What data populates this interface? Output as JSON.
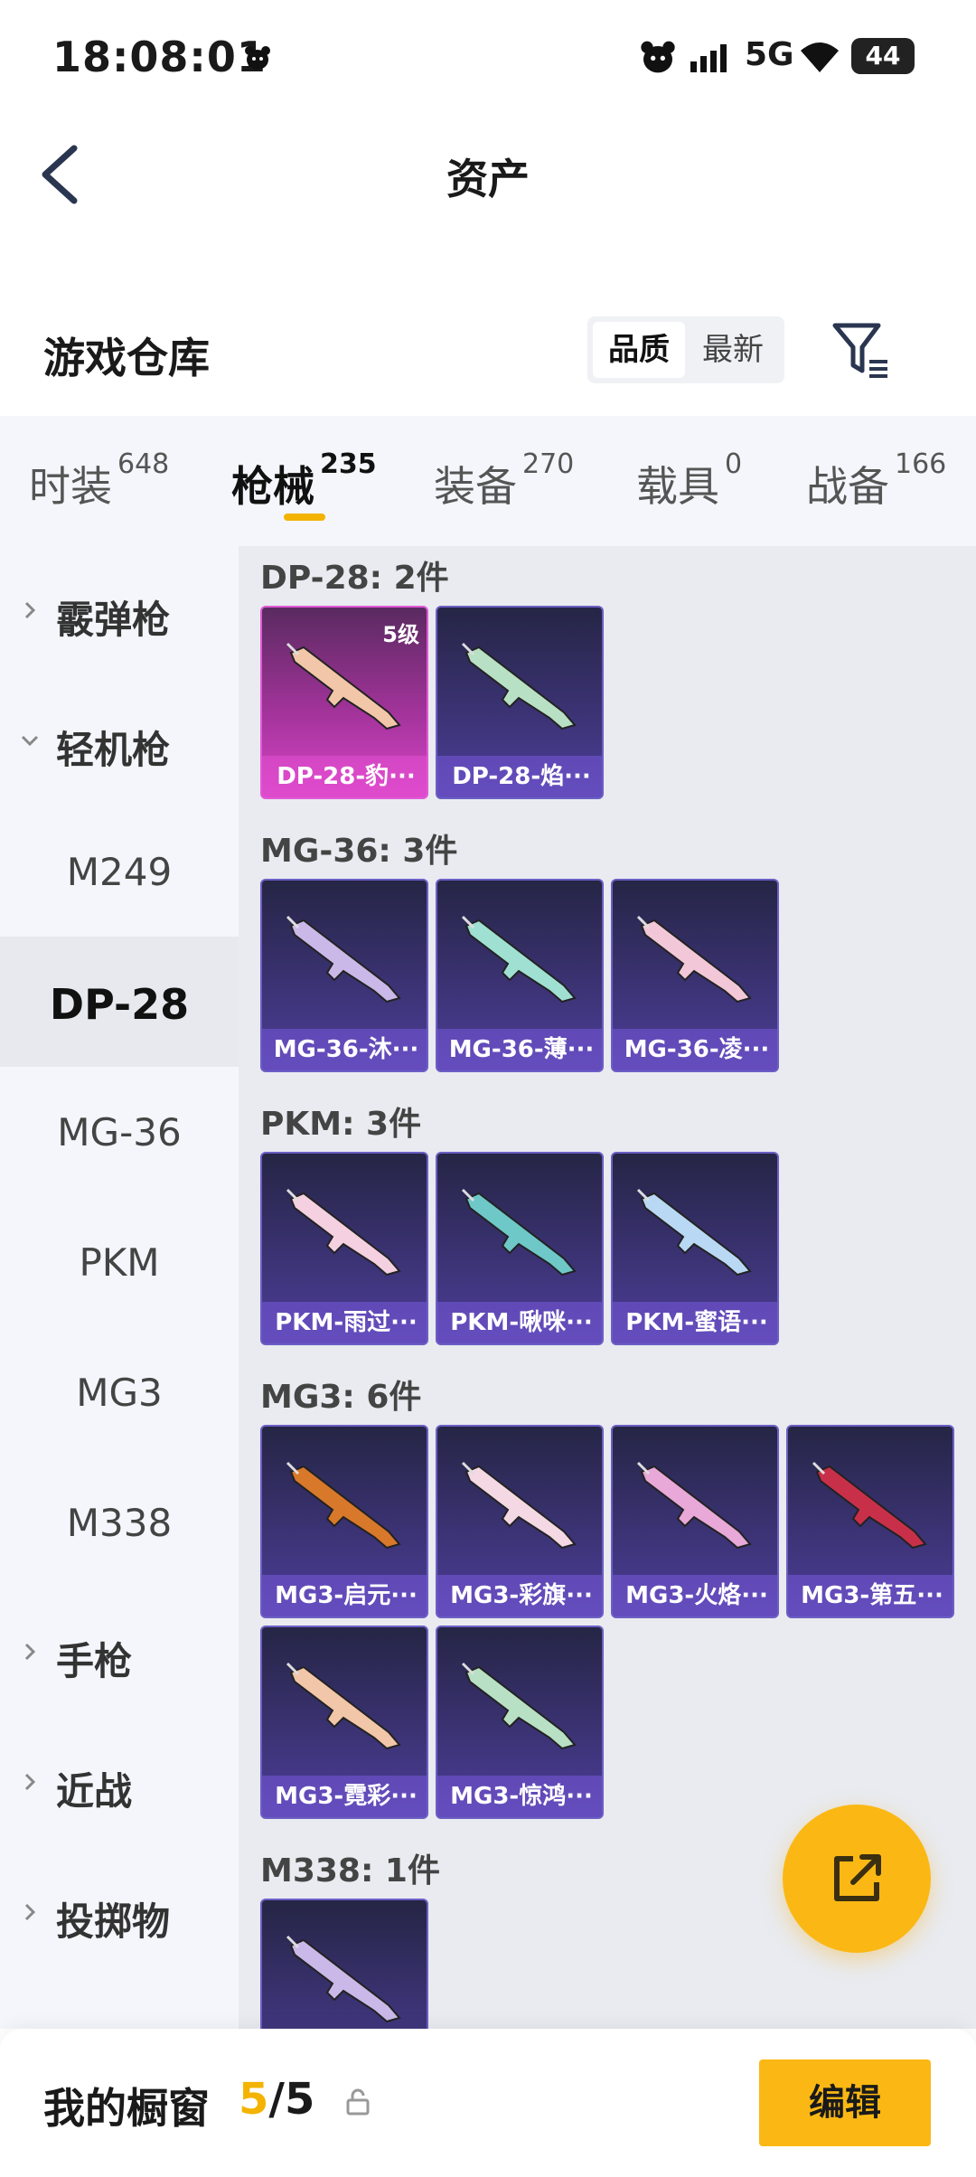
{
  "status_bar": {
    "time": "18:08:01",
    "network": "5G",
    "battery": "44"
  },
  "header": {
    "title": "资产"
  },
  "section": {
    "title": "游戏仓库",
    "sort_options": [
      "品质",
      "最新"
    ]
  },
  "tabs": [
    {
      "label": "时装",
      "count": "648"
    },
    {
      "label": "枪械",
      "count": "235"
    },
    {
      "label": "装备",
      "count": "270"
    },
    {
      "label": "载具",
      "count": "0"
    },
    {
      "label": "战备",
      "count": "166"
    }
  ],
  "sidebar": [
    {
      "label": "霰弹枪",
      "kind": "group"
    },
    {
      "label": "轻机枪",
      "kind": "group-open"
    },
    {
      "label": "M249",
      "kind": "sub"
    },
    {
      "label": "DP-28",
      "kind": "sub-active"
    },
    {
      "label": "MG-36",
      "kind": "sub"
    },
    {
      "label": "PKM",
      "kind": "sub"
    },
    {
      "label": "MG3",
      "kind": "sub"
    },
    {
      "label": "M338",
      "kind": "sub"
    },
    {
      "label": "手枪",
      "kind": "group"
    },
    {
      "label": "近战",
      "kind": "group"
    },
    {
      "label": "投掷物",
      "kind": "group"
    }
  ],
  "groups": [
    {
      "title": "DP-28: 2件",
      "items": [
        {
          "name": "DP-28-豹···",
          "level": "5级",
          "style": "pink"
        },
        {
          "name": "DP-28-焰···"
        }
      ]
    },
    {
      "title": "MG-36: 3件",
      "items": [
        {
          "name": "MG-36-沐···"
        },
        {
          "name": "MG-36-薄···"
        },
        {
          "name": "MG-36-凌···"
        }
      ]
    },
    {
      "title": "PKM: 3件",
      "items": [
        {
          "name": "PKM-雨过···"
        },
        {
          "name": "PKM-啾咪···"
        },
        {
          "name": "PKM-蜜语···"
        }
      ]
    },
    {
      "title": "MG3: 6件",
      "items": [
        {
          "name": "MG3-启元···"
        },
        {
          "name": "MG3-彩旗···"
        },
        {
          "name": "MG3-火烙···"
        },
        {
          "name": "MG3-第五···"
        },
        {
          "name": "MG3-霓彩···"
        },
        {
          "name": "MG3-惊鸿···"
        }
      ]
    },
    {
      "title": "M338: 1件",
      "items": []
    }
  ],
  "bottom": {
    "label": "我的橱窗",
    "current": "5",
    "total": "/5",
    "edit": "编辑"
  },
  "colors": {
    "accent": "#fbb814",
    "card": "#3d3478",
    "card_rare": "#d845c8"
  }
}
